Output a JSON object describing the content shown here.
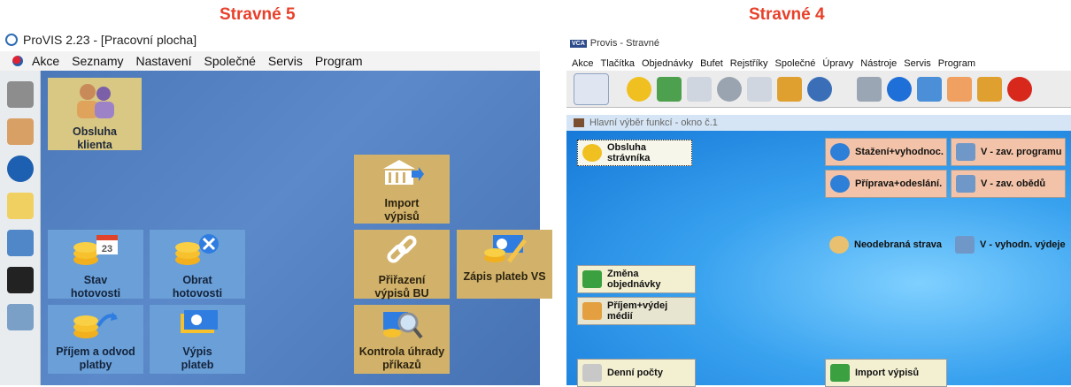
{
  "left": {
    "heading": "Stravné 5",
    "window_title": "ProVIS 2.23 - [Pracovní plocha]",
    "menu": [
      "Akce",
      "Seznamy",
      "Nastavení",
      "Společné",
      "Servis",
      "Program"
    ],
    "tiles": {
      "obsluha_klienta": "Obsluha klienta",
      "import_vypisu": "Import výpisů",
      "stav_hotovosti": "Stav hotovosti",
      "obrat_hotovosti": "Obrat hotovosti",
      "prirazeni_vypisu": "Přiřazení výpisů BU",
      "zapis_plateb": "Zápis plateb VS",
      "prijem_odvod": "Příjem a odvod platby",
      "vypis_plateb": "Výpis plateb",
      "kontrola_uhrady": "Kontrola úhrady příkazů"
    },
    "colors": {
      "desk": "#4f7fc0",
      "khaki": "#d9c784",
      "blue": "#6a9fd8",
      "sand": "#d2b26a"
    }
  },
  "right": {
    "heading": "Stravné 4",
    "window_title": "Provis - Stravné",
    "menu": [
      "Akce",
      "Tlačítka",
      "Objednávky",
      "Bufet",
      "Rejstříky",
      "Společné",
      "Úpravy",
      "Nástroje",
      "Servis",
      "Program"
    ],
    "inner_window_title": "Hlavní výběr funkcí - okno č.1",
    "buttons": {
      "obsluha_stravnika": "Obsluha strávníka",
      "stazeni": "Stažení+vyhodnoc.",
      "v_zav_programu": "V - zav. programu",
      "priprava": "Příprava+odeslání.",
      "v_zav_obedu": "V - zav. obědů",
      "neodebrana": "Neodebraná strava",
      "v_vyhodn": "V - vyhodn. výdeje",
      "zmena_objednavky": "Změna objednávky",
      "prijem_vydej": "Příjem+výdej médií",
      "denni_pocty": "Denní počty",
      "import_vypisu": "Import výpisů"
    },
    "colors": {
      "cream": "#f3f0d2",
      "salmon": "#f2c3a8",
      "desk": "#39a2ef"
    }
  }
}
